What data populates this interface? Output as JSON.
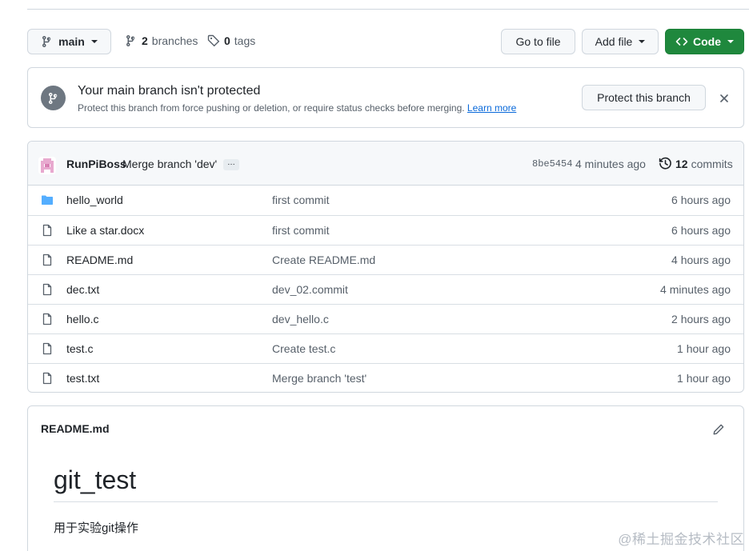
{
  "toolbar": {
    "branch_label": "main",
    "branches_count": "2",
    "branches_label": "branches",
    "tags_count": "0",
    "tags_label": "tags",
    "goto_label": "Go to file",
    "addfile_label": "Add file",
    "code_label": "Code",
    "accent_color": "#1f883d"
  },
  "banner": {
    "title": "Your main branch isn't protected",
    "description": "Protect this branch from force pushing or deletion, or require status checks before merging.",
    "learn_more": "Learn more",
    "protect_label": "Protect this branch"
  },
  "commit": {
    "author": "RunPiBoss",
    "message": "Merge branch 'dev'",
    "ellipsis": "…",
    "sha": "8be5454",
    "age": "4 minutes ago",
    "commits_count": "12",
    "commits_label": "commits"
  },
  "files": [
    {
      "type": "folder",
      "name": "hello_world",
      "message": "first commit",
      "age": "6 hours ago"
    },
    {
      "type": "file",
      "name": "Like a star.docx",
      "message": "first commit",
      "age": "6 hours ago"
    },
    {
      "type": "file",
      "name": "README.md",
      "message": "Create README.md",
      "age": "4 hours ago"
    },
    {
      "type": "file",
      "name": "dec.txt",
      "message": "dev_02.commit",
      "age": "4 minutes ago"
    },
    {
      "type": "file",
      "name": "hello.c",
      "message": "dev_hello.c",
      "age": "2 hours ago"
    },
    {
      "type": "file",
      "name": "test.c",
      "message": "Create test.c",
      "age": "1 hour ago"
    },
    {
      "type": "file",
      "name": "test.txt",
      "message": "Merge branch 'test'",
      "age": "1 hour ago"
    }
  ],
  "readme": {
    "header": "README.md",
    "heading": "git_test",
    "body": "用于实验git操作"
  },
  "watermark": "@稀土掘金技术社区"
}
